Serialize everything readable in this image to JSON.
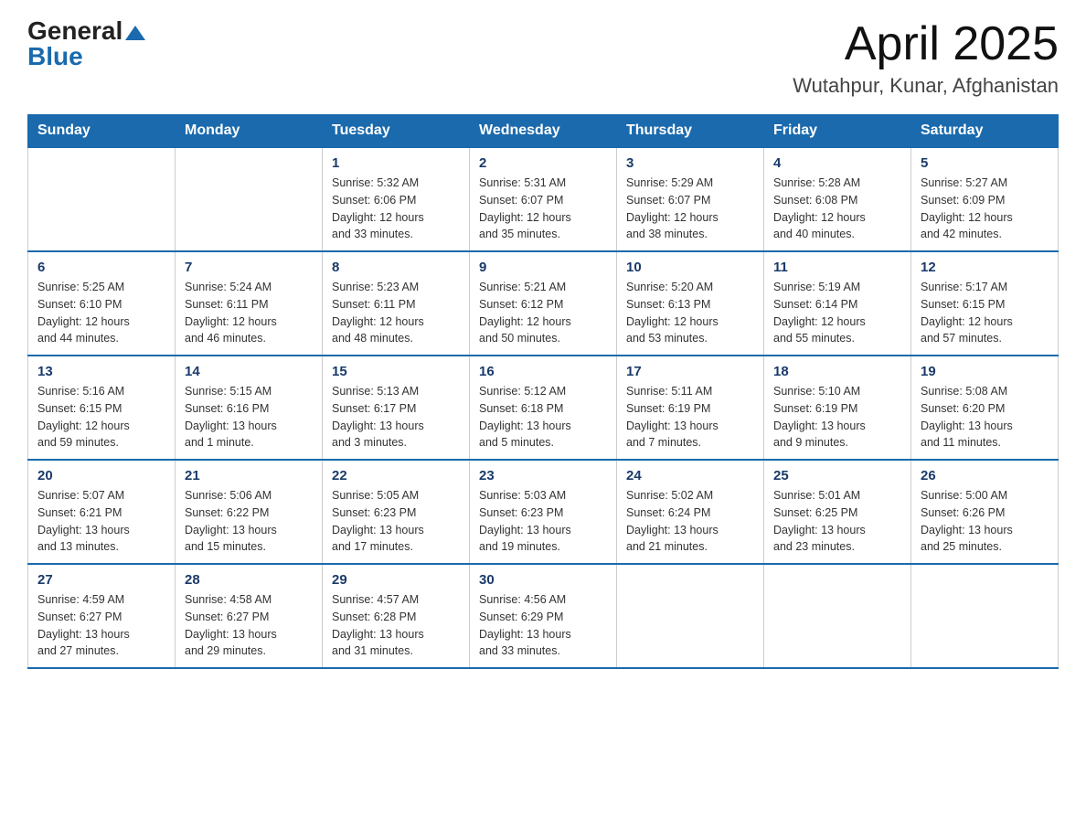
{
  "header": {
    "logo": {
      "general": "General",
      "arrow": "▲",
      "blue": "Blue"
    },
    "title": "April 2025",
    "location": "Wutahpur, Kunar, Afghanistan"
  },
  "days_of_week": [
    "Sunday",
    "Monday",
    "Tuesday",
    "Wednesday",
    "Thursday",
    "Friday",
    "Saturday"
  ],
  "weeks": [
    [
      {
        "day": "",
        "info": ""
      },
      {
        "day": "",
        "info": ""
      },
      {
        "day": "1",
        "info": "Sunrise: 5:32 AM\nSunset: 6:06 PM\nDaylight: 12 hours\nand 33 minutes."
      },
      {
        "day": "2",
        "info": "Sunrise: 5:31 AM\nSunset: 6:07 PM\nDaylight: 12 hours\nand 35 minutes."
      },
      {
        "day": "3",
        "info": "Sunrise: 5:29 AM\nSunset: 6:07 PM\nDaylight: 12 hours\nand 38 minutes."
      },
      {
        "day": "4",
        "info": "Sunrise: 5:28 AM\nSunset: 6:08 PM\nDaylight: 12 hours\nand 40 minutes."
      },
      {
        "day": "5",
        "info": "Sunrise: 5:27 AM\nSunset: 6:09 PM\nDaylight: 12 hours\nand 42 minutes."
      }
    ],
    [
      {
        "day": "6",
        "info": "Sunrise: 5:25 AM\nSunset: 6:10 PM\nDaylight: 12 hours\nand 44 minutes."
      },
      {
        "day": "7",
        "info": "Sunrise: 5:24 AM\nSunset: 6:11 PM\nDaylight: 12 hours\nand 46 minutes."
      },
      {
        "day": "8",
        "info": "Sunrise: 5:23 AM\nSunset: 6:11 PM\nDaylight: 12 hours\nand 48 minutes."
      },
      {
        "day": "9",
        "info": "Sunrise: 5:21 AM\nSunset: 6:12 PM\nDaylight: 12 hours\nand 50 minutes."
      },
      {
        "day": "10",
        "info": "Sunrise: 5:20 AM\nSunset: 6:13 PM\nDaylight: 12 hours\nand 53 minutes."
      },
      {
        "day": "11",
        "info": "Sunrise: 5:19 AM\nSunset: 6:14 PM\nDaylight: 12 hours\nand 55 minutes."
      },
      {
        "day": "12",
        "info": "Sunrise: 5:17 AM\nSunset: 6:15 PM\nDaylight: 12 hours\nand 57 minutes."
      }
    ],
    [
      {
        "day": "13",
        "info": "Sunrise: 5:16 AM\nSunset: 6:15 PM\nDaylight: 12 hours\nand 59 minutes."
      },
      {
        "day": "14",
        "info": "Sunrise: 5:15 AM\nSunset: 6:16 PM\nDaylight: 13 hours\nand 1 minute."
      },
      {
        "day": "15",
        "info": "Sunrise: 5:13 AM\nSunset: 6:17 PM\nDaylight: 13 hours\nand 3 minutes."
      },
      {
        "day": "16",
        "info": "Sunrise: 5:12 AM\nSunset: 6:18 PM\nDaylight: 13 hours\nand 5 minutes."
      },
      {
        "day": "17",
        "info": "Sunrise: 5:11 AM\nSunset: 6:19 PM\nDaylight: 13 hours\nand 7 minutes."
      },
      {
        "day": "18",
        "info": "Sunrise: 5:10 AM\nSunset: 6:19 PM\nDaylight: 13 hours\nand 9 minutes."
      },
      {
        "day": "19",
        "info": "Sunrise: 5:08 AM\nSunset: 6:20 PM\nDaylight: 13 hours\nand 11 minutes."
      }
    ],
    [
      {
        "day": "20",
        "info": "Sunrise: 5:07 AM\nSunset: 6:21 PM\nDaylight: 13 hours\nand 13 minutes."
      },
      {
        "day": "21",
        "info": "Sunrise: 5:06 AM\nSunset: 6:22 PM\nDaylight: 13 hours\nand 15 minutes."
      },
      {
        "day": "22",
        "info": "Sunrise: 5:05 AM\nSunset: 6:23 PM\nDaylight: 13 hours\nand 17 minutes."
      },
      {
        "day": "23",
        "info": "Sunrise: 5:03 AM\nSunset: 6:23 PM\nDaylight: 13 hours\nand 19 minutes."
      },
      {
        "day": "24",
        "info": "Sunrise: 5:02 AM\nSunset: 6:24 PM\nDaylight: 13 hours\nand 21 minutes."
      },
      {
        "day": "25",
        "info": "Sunrise: 5:01 AM\nSunset: 6:25 PM\nDaylight: 13 hours\nand 23 minutes."
      },
      {
        "day": "26",
        "info": "Sunrise: 5:00 AM\nSunset: 6:26 PM\nDaylight: 13 hours\nand 25 minutes."
      }
    ],
    [
      {
        "day": "27",
        "info": "Sunrise: 4:59 AM\nSunset: 6:27 PM\nDaylight: 13 hours\nand 27 minutes."
      },
      {
        "day": "28",
        "info": "Sunrise: 4:58 AM\nSunset: 6:27 PM\nDaylight: 13 hours\nand 29 minutes."
      },
      {
        "day": "29",
        "info": "Sunrise: 4:57 AM\nSunset: 6:28 PM\nDaylight: 13 hours\nand 31 minutes."
      },
      {
        "day": "30",
        "info": "Sunrise: 4:56 AM\nSunset: 6:29 PM\nDaylight: 13 hours\nand 33 minutes."
      },
      {
        "day": "",
        "info": ""
      },
      {
        "day": "",
        "info": ""
      },
      {
        "day": "",
        "info": ""
      }
    ]
  ]
}
